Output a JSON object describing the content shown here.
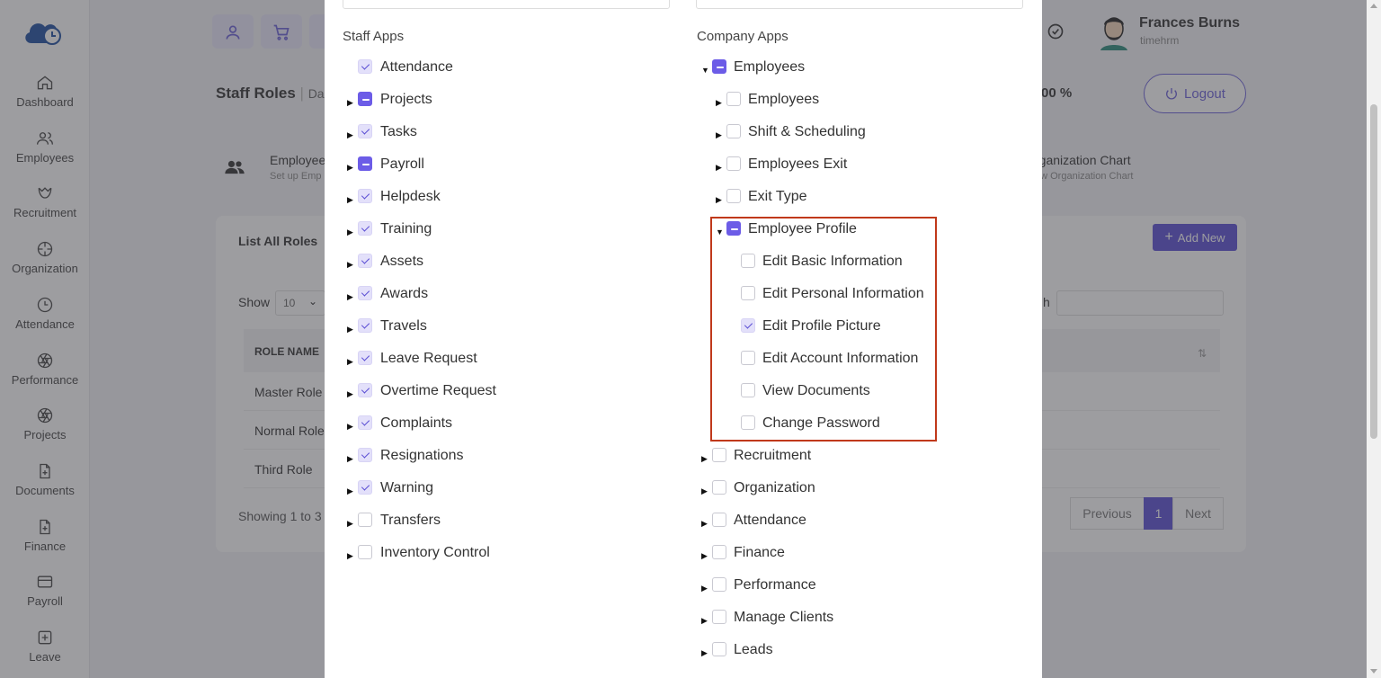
{
  "sidebar": {
    "items": [
      {
        "label": "Dashboard",
        "icon": "home-icon"
      },
      {
        "label": "Employees",
        "icon": "users-icon"
      },
      {
        "label": "Recruitment",
        "icon": "recruitment-icon"
      },
      {
        "label": "Organization",
        "icon": "crosshair-icon"
      },
      {
        "label": "Attendance",
        "icon": "clock-icon"
      },
      {
        "label": "Performance",
        "icon": "aperture-icon"
      },
      {
        "label": "Projects",
        "icon": "aperture-icon"
      },
      {
        "label": "Documents",
        "icon": "file-plus-icon"
      },
      {
        "label": "Finance",
        "icon": "file-plus-icon"
      },
      {
        "label": "Payroll",
        "icon": "credit-card-icon"
      },
      {
        "label": "Leave",
        "icon": "plus-square-icon"
      }
    ]
  },
  "header": {
    "user_name": "Frances Burns",
    "user_sub": "timehrm",
    "logout_label": "Logout",
    "page_title": "Staff Roles",
    "page_title_trail": "Da",
    "percent": "00 %"
  },
  "cards": {
    "employees_title": "Employee",
    "employees_sub": "Set up Emp",
    "org_title": "rganization Chart",
    "org_sub": "ew Organization Chart"
  },
  "roles_panel": {
    "title": "List All Roles",
    "add_new_label": "Add New",
    "show_label": "Show",
    "show_value": "10",
    "search_label": "h",
    "column_header": "ROLE NAME",
    "rows": [
      "Master Role",
      "Normal Role",
      "Third Role"
    ],
    "showing_text": "Showing 1 to 3",
    "pagination": {
      "previous": "Previous",
      "page": "1",
      "next": "Next"
    }
  },
  "modal": {
    "staff_heading": "Staff Apps",
    "company_heading": "Company Apps",
    "staff_apps": [
      {
        "label": "Attendance",
        "state": "checked",
        "arrow": false
      },
      {
        "label": "Projects",
        "state": "partial",
        "arrow": true
      },
      {
        "label": "Tasks",
        "state": "checked",
        "arrow": true
      },
      {
        "label": "Payroll",
        "state": "partial",
        "arrow": true
      },
      {
        "label": "Helpdesk",
        "state": "checked",
        "arrow": true
      },
      {
        "label": "Training",
        "state": "checked",
        "arrow": true
      },
      {
        "label": "Assets",
        "state": "checked",
        "arrow": true
      },
      {
        "label": "Awards",
        "state": "checked",
        "arrow": true
      },
      {
        "label": "Travels",
        "state": "checked",
        "arrow": true
      },
      {
        "label": "Leave Request",
        "state": "checked",
        "arrow": true
      },
      {
        "label": "Overtime Request",
        "state": "checked",
        "arrow": true
      },
      {
        "label": "Complaints",
        "state": "checked",
        "arrow": true
      },
      {
        "label": "Resignations",
        "state": "checked",
        "arrow": true
      },
      {
        "label": "Warning",
        "state": "checked",
        "arrow": true
      },
      {
        "label": "Transfers",
        "state": "unchecked",
        "arrow": true
      },
      {
        "label": "Inventory Control",
        "state": "unchecked",
        "arrow": true
      }
    ],
    "company_apps": [
      {
        "label": "Employees",
        "state": "partial",
        "arrow": "down",
        "level": 0
      },
      {
        "label": "Employees",
        "state": "unchecked",
        "arrow": "right",
        "level": 1
      },
      {
        "label": "Shift & Scheduling",
        "state": "unchecked",
        "arrow": "right",
        "level": 1
      },
      {
        "label": "Employees Exit",
        "state": "unchecked",
        "arrow": "right",
        "level": 1
      },
      {
        "label": "Exit Type",
        "state": "unchecked",
        "arrow": "right",
        "level": 1
      },
      {
        "label": "Employee Profile",
        "state": "partial",
        "arrow": "down",
        "level": 1
      },
      {
        "label": "Edit Basic Information",
        "state": "unchecked",
        "arrow": "none",
        "level": 2
      },
      {
        "label": "Edit Personal Information",
        "state": "unchecked",
        "arrow": "none",
        "level": 2
      },
      {
        "label": "Edit Profile Picture",
        "state": "checked",
        "arrow": "none",
        "level": 2
      },
      {
        "label": "Edit Account Information",
        "state": "unchecked",
        "arrow": "none",
        "level": 2
      },
      {
        "label": "View Documents",
        "state": "unchecked",
        "arrow": "none",
        "level": 2
      },
      {
        "label": "Change Password",
        "state": "unchecked",
        "arrow": "none",
        "level": 2
      },
      {
        "label": "Recruitment",
        "state": "unchecked",
        "arrow": "right",
        "level": 0
      },
      {
        "label": "Organization",
        "state": "unchecked",
        "arrow": "right",
        "level": 0
      },
      {
        "label": "Attendance",
        "state": "unchecked",
        "arrow": "right",
        "level": 0
      },
      {
        "label": "Finance",
        "state": "unchecked",
        "arrow": "right",
        "level": 0
      },
      {
        "label": "Performance",
        "state": "unchecked",
        "arrow": "right",
        "level": 0
      },
      {
        "label": "Manage Clients",
        "state": "unchecked",
        "arrow": "right",
        "level": 0
      },
      {
        "label": "Leads",
        "state": "unchecked",
        "arrow": "right",
        "level": 0
      }
    ]
  },
  "colors": {
    "accent": "#5b4fd4",
    "highlight_border": "#c0391b",
    "overlay": "rgba(60,60,66,0.5)"
  }
}
